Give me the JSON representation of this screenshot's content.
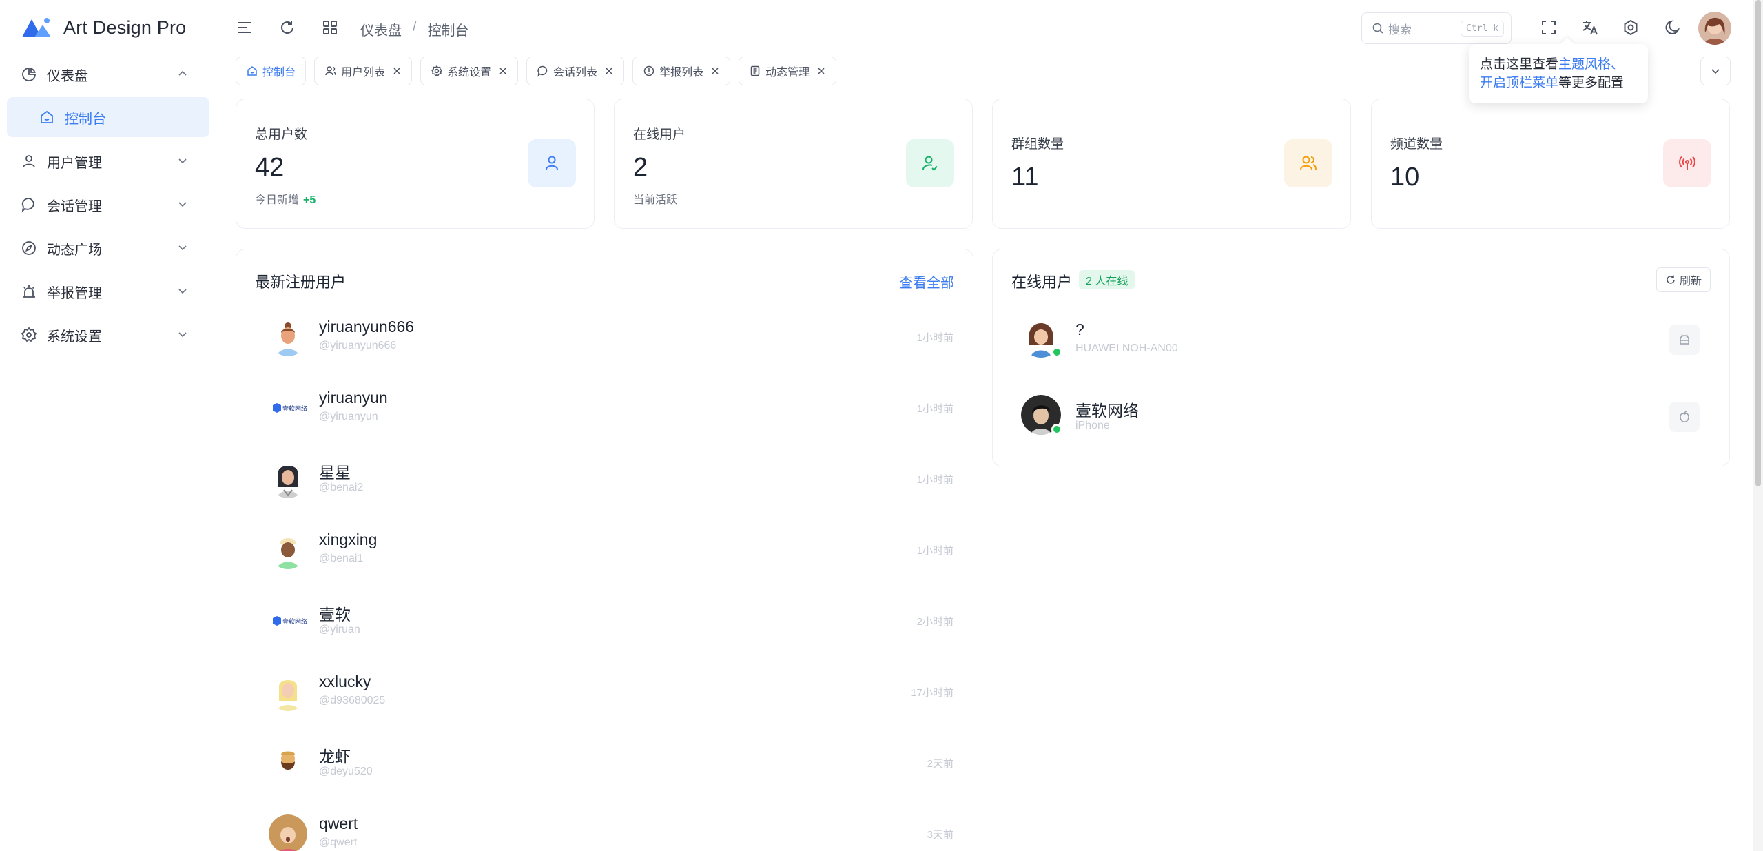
{
  "app": {
    "name": "Art Design Pro"
  },
  "sidebar": {
    "items": [
      {
        "label": "仪表盘",
        "icon": "pie-chart-icon",
        "expanded": true
      },
      {
        "label": "控制台",
        "icon": "home-icon",
        "active": true
      },
      {
        "label": "用户管理",
        "icon": "user-icon"
      },
      {
        "label": "会话管理",
        "icon": "chat-icon"
      },
      {
        "label": "动态广场",
        "icon": "compass-icon"
      },
      {
        "label": "举报管理",
        "icon": "alarm-icon"
      },
      {
        "label": "系统设置",
        "icon": "gear-icon"
      }
    ]
  },
  "breadcrumb": {
    "parent": "仪表盘",
    "separator": "/",
    "current": "控制台"
  },
  "search": {
    "placeholder": "搜索",
    "shortcut": "Ctrl k"
  },
  "tooltip": {
    "prefix": "点击这里查看",
    "link1": "主题风格",
    "mid": "、",
    "link2": "开启顶栏菜单",
    "suffix": "等更多配置"
  },
  "tabs": [
    {
      "label": "控制台",
      "icon": "home-icon",
      "active": true,
      "closable": false
    },
    {
      "label": "用户列表",
      "icon": "users-icon",
      "closable": true
    },
    {
      "label": "系统设置",
      "icon": "gear-icon",
      "closable": true
    },
    {
      "label": "会话列表",
      "icon": "chat-icon",
      "closable": true
    },
    {
      "label": "举报列表",
      "icon": "alert-icon",
      "closable": true
    },
    {
      "label": "动态管理",
      "icon": "document-icon",
      "closable": true
    }
  ],
  "stats": [
    {
      "label": "总用户数",
      "value": "42",
      "sub": "今日新增",
      "delta": "+5",
      "icon": "user-icon",
      "color": "#3b7cf0",
      "bg": "#e8f1fe"
    },
    {
      "label": "在线用户",
      "value": "2",
      "sub": "当前活跃",
      "icon": "user-check-icon",
      "color": "#17b26a",
      "bg": "#e5f8ef"
    },
    {
      "label": "群组数量",
      "value": "11",
      "icon": "users-icon",
      "color": "#f59e0b",
      "bg": "#fdf3e4"
    },
    {
      "label": "频道数量",
      "value": "10",
      "icon": "broadcast-icon",
      "color": "#ef4444",
      "bg": "#fdeaea"
    }
  ],
  "recent_users": {
    "title": "最新注册用户",
    "view_all": "查看全部",
    "rows": [
      {
        "name": "yiruanyun666",
        "handle": "@yiruanyun666",
        "time": "1小时前",
        "avatar": "avatar-man-bun"
      },
      {
        "name": "yiruanyun",
        "handle": "@yiruanyun",
        "time": "1小时前",
        "avatar": "avatar-logo"
      },
      {
        "name": "星星",
        "handle": "@benai2",
        "time": "1小时前",
        "avatar": "avatar-woman-dark"
      },
      {
        "name": "xingxing",
        "handle": "@benai1",
        "time": "1小时前",
        "avatar": "avatar-man-beanie"
      },
      {
        "name": "壹软",
        "handle": "@yiruan",
        "time": "2小时前",
        "avatar": "avatar-logo"
      },
      {
        "name": "xxlucky",
        "handle": "@d93680025",
        "time": "17小时前",
        "avatar": "avatar-woman-blonde"
      },
      {
        "name": "龙虾",
        "handle": "@deyu520",
        "time": "2天前",
        "avatar": "avatar-man-beard"
      },
      {
        "name": "qwert",
        "handle": "@qwert",
        "time": "3天前",
        "avatar": "avatar-woman-shock"
      }
    ],
    "logo_text": "壹软网络"
  },
  "online_users": {
    "title": "在线用户",
    "badge": "2 人在线",
    "refresh": "刷新",
    "rows": [
      {
        "name": "?",
        "device": "HUAWEI NOH-AN00",
        "device_icon": "android-icon"
      },
      {
        "name": "壹软网络",
        "device": "iPhone",
        "device_icon": "apple-icon"
      }
    ]
  }
}
